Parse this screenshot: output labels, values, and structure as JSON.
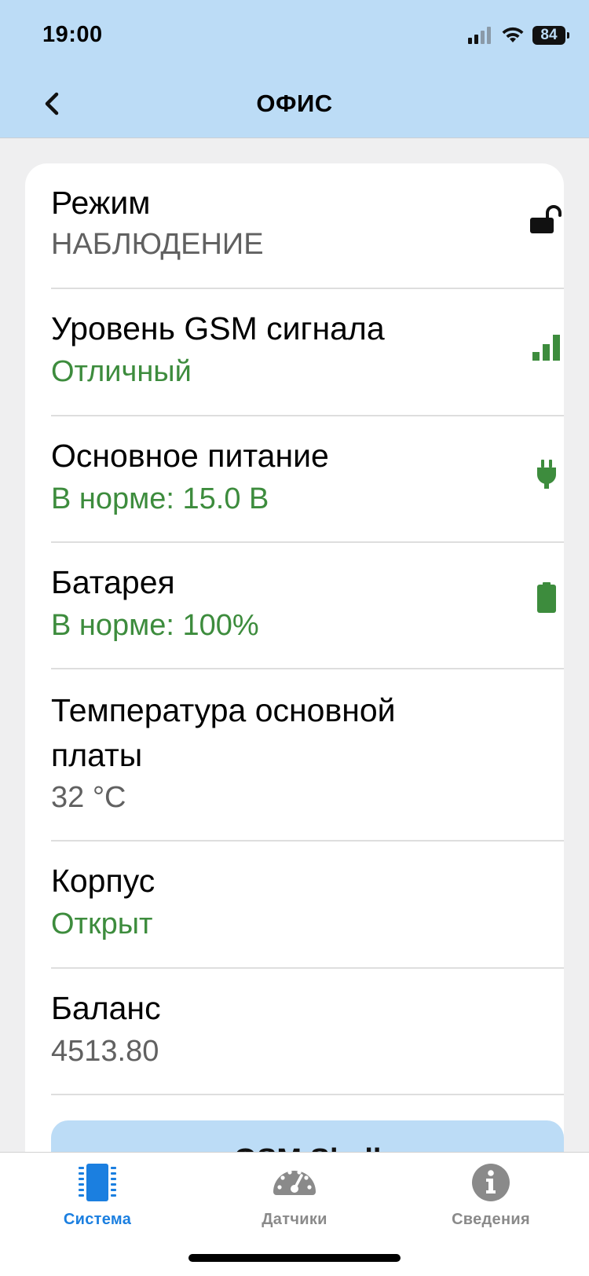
{
  "status_bar": {
    "time": "19:00",
    "battery": "84"
  },
  "header": {
    "title": "ОФИС"
  },
  "rows": [
    {
      "title": "Режим",
      "value": "НАБЛЮДЕНИЕ",
      "icon": "unlocked-padlock-icon"
    },
    {
      "title": "Уровень GSM сигнала",
      "value": "Отличный",
      "icon": "signal-bars-icon"
    },
    {
      "title": "Основное питание",
      "value": "В норме: 15.0 В",
      "icon": "power-plug-icon"
    },
    {
      "title": "Батарея",
      "value": "В норме: 100%",
      "icon": "battery-full-icon"
    },
    {
      "title_line1": "Температура основной",
      "title_line2": "платы",
      "value": "32 °C"
    },
    {
      "title": "Корпус",
      "value": "Открыт"
    },
    {
      "title": "Баланс",
      "value": "4513.80"
    }
  ],
  "gsm_button_label": "GSM Shell",
  "tabs": [
    {
      "label": "Система",
      "icon": "chip-icon",
      "active": true
    },
    {
      "label": "Датчики",
      "icon": "gauge-icon",
      "active": false
    },
    {
      "label": "Сведения",
      "icon": "info-icon",
      "active": false
    }
  ],
  "colors": {
    "header_bg": "#bcdcf6",
    "ok_green": "#3d8c3d",
    "active_tab": "#1b7fe0",
    "inactive_tab": "#8a8a8a"
  }
}
